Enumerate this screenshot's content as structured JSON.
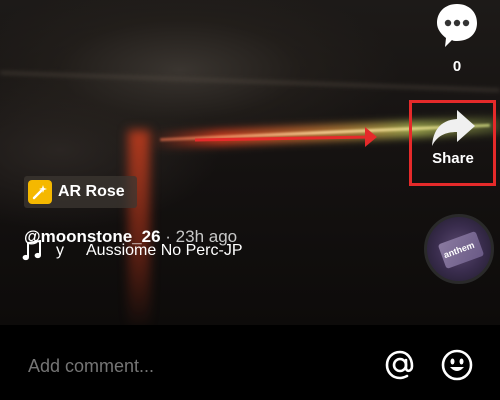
{
  "actions": {
    "comments": {
      "icon": "comment-bubble-icon",
      "count": "0"
    },
    "share": {
      "icon": "share-arrow-icon",
      "label": "Share"
    }
  },
  "effect": {
    "icon": "wand-sparkle-icon",
    "label": "AR Rose"
  },
  "post": {
    "username": "@moonstone_26",
    "separator": " · ",
    "time_ago": "23h ago"
  },
  "music": {
    "icon": "music-note-icon",
    "prefix": "y",
    "title": "Aussiome No Perc-JP",
    "disc_label": "anthem"
  },
  "comment_bar": {
    "placeholder": "Add comment...",
    "mention_icon": "at-sign-icon",
    "emoji_icon": "smiley-icon"
  },
  "colors": {
    "annotation_red": "#e52a2a",
    "effect_badge_yellow": "#f5b800"
  }
}
